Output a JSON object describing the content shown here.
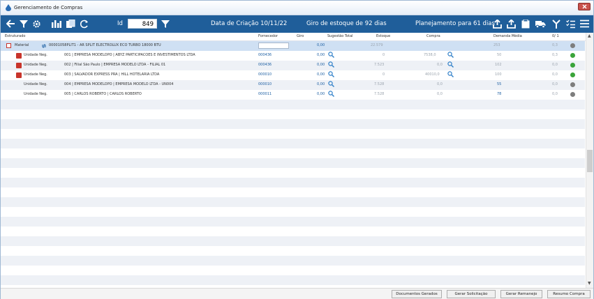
{
  "window": {
    "title": "Gerenciamento de Compras"
  },
  "toolbar": {
    "id_label": "Id",
    "id_value": "849",
    "creation_date": "Data de Criação 10/11/22",
    "stock_turnover": "Giro de estoque de  92 dias",
    "planning": "Planejamento para 61 dias"
  },
  "columns": {
    "estruturado": "Estruturado",
    "fornecedor": "Fornecedor",
    "giro": "Giro",
    "sugestao": "Sugestão Total",
    "estoque": "Estoque",
    "compra": "Compra",
    "demanda": "Demanda Média",
    "ratio": "0/ 1"
  },
  "rows": [
    {
      "type": "Material",
      "desc": "00001058PLIT1 - AR SPLIT ELECTROLUX ECO TURBO 18000 BTU",
      "fornecedor": "",
      "sugestao": "0,00",
      "estoque": "22.579",
      "compra": "",
      "demanda": "253",
      "ratio": "0,3",
      "status": "grey"
    },
    {
      "type": "Unidade Neg.",
      "desc": "001 | EMPRESA MODELOPO | ABYZ PARTICIPACOES E INVESTIMENTOS LTDA",
      "fornecedor": "000436",
      "sugestao": "0,00",
      "estoque": "0",
      "compra": "7538,0",
      "demanda": "50",
      "ratio": "0,3",
      "status": "green"
    },
    {
      "type": "Unidade Neg.",
      "desc": "002 | Filial São Paulo | EMPRESA MODELO LTDA - FILIAL 01",
      "fornecedor": "000436",
      "sugestao": "0,00",
      "estoque": "7.523",
      "compra": "0,0",
      "demanda": "102",
      "ratio": "0,0",
      "status": "green"
    },
    {
      "type": "Unidade Neg.",
      "desc": "003 | SALVADOR EXPRESS PRA | HILL HOTELARIA LTDA",
      "fornecedor": "000010",
      "sugestao": "0,00",
      "estoque": "0",
      "compra": "40010,0",
      "demanda": "100",
      "ratio": "0,0",
      "status": "green"
    },
    {
      "type": "Unidade Neg.",
      "desc": "004 | EMPRESA MODELOPO | EMPRESA MODELO LTDA - UN004",
      "fornecedor": "000010",
      "sugestao": "0,00",
      "estoque": "7.528",
      "compra": "0,0",
      "demanda": "55",
      "ratio": "0,0",
      "status": "grey"
    },
    {
      "type": "Unidade Neg.",
      "desc": "005 | CARLOS ROBERTO | CARLOS ROBERTO",
      "fornecedor": "000011",
      "sugestao": "0,00",
      "estoque": "7.528",
      "compra": "0,0",
      "demanda": "78",
      "ratio": "0,0",
      "status": "grey"
    }
  ],
  "footer": {
    "docs": "Documentos Gerados",
    "solicitacao": "Gerar Solicitação",
    "remanejo": "Gerar Remanejo",
    "resumo": "Resumo Compra"
  }
}
